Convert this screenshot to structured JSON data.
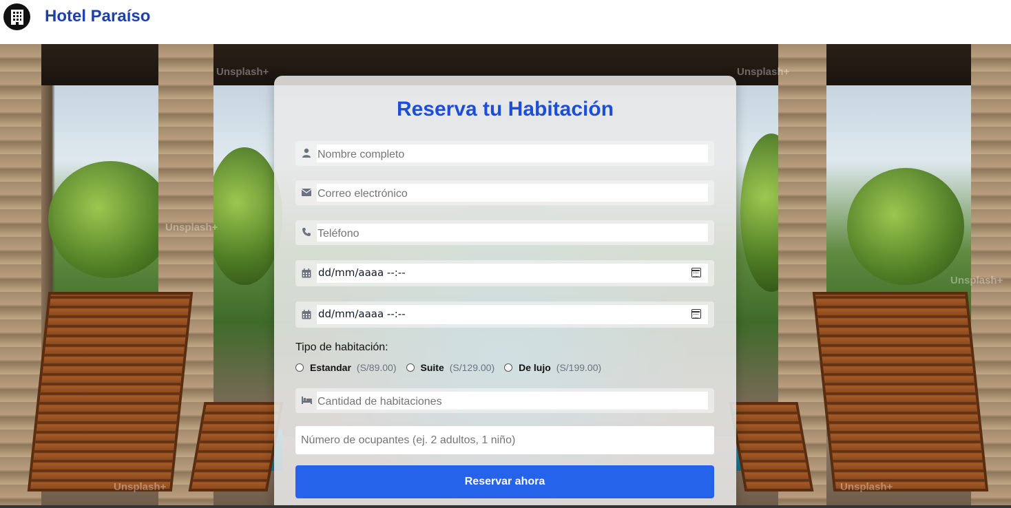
{
  "header": {
    "brand": "Hotel Paraíso",
    "logo_icon": "hotel-building-icon"
  },
  "background": {
    "watermark": "Unsplash+"
  },
  "form": {
    "title": "Reserva tu Habitación",
    "fields": {
      "name": {
        "placeholder": "Nombre completo",
        "icon": "user-icon"
      },
      "email": {
        "placeholder": "Correo electrónico",
        "icon": "envelope-icon"
      },
      "phone": {
        "placeholder": "Teléfono",
        "icon": "phone-icon"
      },
      "checkin": {
        "value": "dd/mm/aaaa  --:--",
        "icon": "calendar-icon"
      },
      "checkout": {
        "value": "dd/mm/aaaa  --:--",
        "icon": "calendar-icon"
      },
      "rooms": {
        "placeholder": "Cantidad de habitaciones",
        "icon": "bed-icon"
      },
      "occupants": {
        "placeholder": "Número de ocupantes (ej. 2 adultos, 1 niño)"
      }
    },
    "room_type": {
      "label": "Tipo de habitación:",
      "options": [
        {
          "name": "Estandar",
          "price": "(S/89.00)"
        },
        {
          "name": "Suite",
          "price": "(S/129.00)"
        },
        {
          "name": "De lujo",
          "price": "(S/199.00)"
        }
      ]
    },
    "submit_label": "Reservar ahora"
  },
  "colors": {
    "accent": "#2563eb",
    "title": "#1d4ed8",
    "brand": "#1e40af"
  }
}
